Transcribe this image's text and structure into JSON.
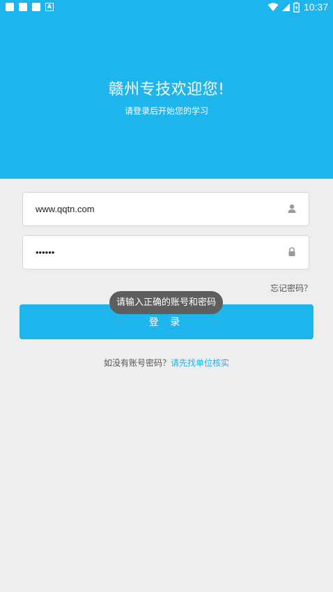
{
  "status_bar": {
    "left_icons": [
      "notification-square-icon",
      "notification-square-icon",
      "notification-square-icon",
      "a-letter-icon"
    ],
    "a_label": "A",
    "right_icons": [
      "wifi-icon",
      "cell-signal-icon",
      "battery-icon"
    ],
    "time": "10:37"
  },
  "header": {
    "title": "赣州专技欢迎您!",
    "subtitle": "请登录后开始您的学习",
    "background_color": "#1eb4ec"
  },
  "login_form": {
    "username_value": "www.qqtn.com",
    "username_icon": "user-icon",
    "password_value": "••••••",
    "password_icon": "lock-icon",
    "forgot_password": "忘记密码？",
    "login_button": "登 录"
  },
  "toast": {
    "message": "请输入正确的账号和密码"
  },
  "footer": {
    "hint_text": "如没有账号密码？",
    "hint_link": "请先找单位核实",
    "link_color": "#1eb4ec"
  }
}
